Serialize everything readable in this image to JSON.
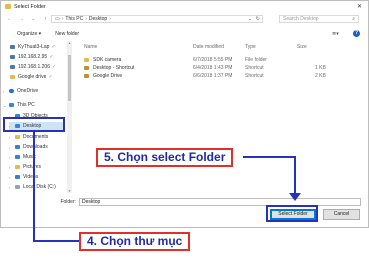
{
  "window": {
    "title": "Select Folder"
  },
  "address_bar": {
    "crumbs": [
      "This PC",
      "Desktop"
    ],
    "separator": "›",
    "search_placeholder": "Search Desktop"
  },
  "toolbar": {
    "organize": "Organize ▾",
    "new_folder": "New folder",
    "view_icon": "≣▾",
    "help": "?"
  },
  "nav_pane": {
    "items": [
      {
        "label": "KyThuat3-Lap",
        "icon": "network-icon",
        "pinned": true
      },
      {
        "label": "192.168.2.95",
        "icon": "network-icon",
        "pinned": true
      },
      {
        "label": "192.168.1.206",
        "icon": "network-icon",
        "pinned": true
      },
      {
        "label": "Google drive",
        "icon": "folder-icon",
        "pinned": true
      },
      {
        "label": "OneDrive",
        "icon": "cloud-icon",
        "pinned": false
      },
      {
        "label": "This PC",
        "icon": "computer-icon",
        "pinned": false
      },
      {
        "label": "3D Objects",
        "icon": "folder-icon",
        "pinned": false
      },
      {
        "label": "Desktop",
        "icon": "folder-icon",
        "pinned": false,
        "selected": true
      },
      {
        "label": "Documents",
        "icon": "folder-icon",
        "pinned": false
      },
      {
        "label": "Downloads",
        "icon": "folder-icon",
        "pinned": false
      },
      {
        "label": "Music",
        "icon": "folder-icon",
        "pinned": false
      },
      {
        "label": "Pictures",
        "icon": "folder-icon",
        "pinned": false
      },
      {
        "label": "Videos",
        "icon": "folder-icon",
        "pinned": false
      },
      {
        "label": "Local Disk (C:)",
        "icon": "disk-icon",
        "pinned": false
      }
    ]
  },
  "file_list": {
    "columns": [
      "Name",
      "Date modified",
      "Type",
      "Size"
    ],
    "rows": [
      {
        "name": "SDK camera",
        "date": "6/7/2018 5:55 PM",
        "type": "File folder",
        "size": ""
      },
      {
        "name": "Desktop - Shortcut",
        "date": "6/4/2018 1:43 PM",
        "type": "Shortcut",
        "size": "1 KB"
      },
      {
        "name": "Google Drive",
        "date": "6/6/2018 1:37 PM",
        "type": "Shortcut",
        "size": "2 KB"
      }
    ]
  },
  "folder_field": {
    "label": "Folder:",
    "value": "Desktop"
  },
  "buttons": {
    "select": "Select Folder",
    "cancel": "Cancel"
  },
  "annotations": {
    "step5": "5. Chọn select Folder",
    "step4": "4. Chọn thư mục"
  },
  "colors": {
    "annotation_border": "#e0302b",
    "annotation_text": "#1f2aa6",
    "arrow": "#2633b8",
    "selected_bg": "#cde4f7"
  }
}
